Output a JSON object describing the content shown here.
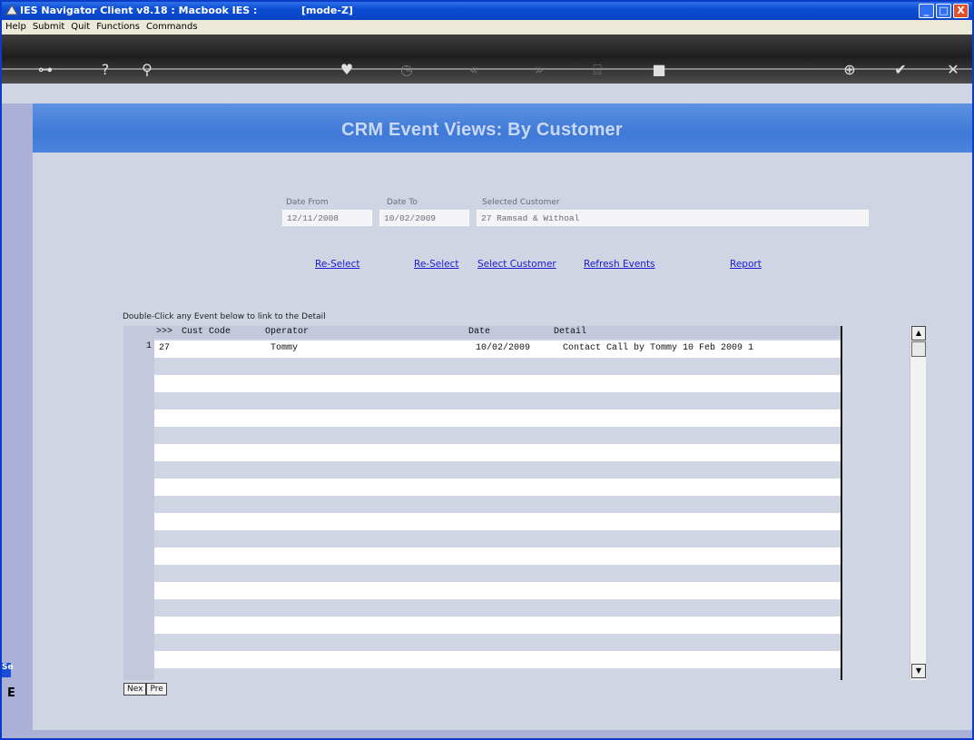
{
  "window": {
    "title": "IES Navigator Client v8.18 : Macbook IES :",
    "mode": "[mode-Z]",
    "buttons": {
      "minimize": "_",
      "maximize": "□",
      "close": "X"
    }
  },
  "menu": [
    "Help",
    "Submit",
    "Quit",
    "Functions",
    "Commands"
  ],
  "toolbar": {
    "icons": [
      "key-icon",
      "help-icon",
      "search-icon",
      "heart-icon",
      "clock-icon",
      "back-icon",
      "forward-icon",
      "tree-icon",
      "stop-icon",
      "globe-icon",
      "check-icon",
      "close-icon"
    ]
  },
  "banner": {
    "title": "CRM Event Views: By Customer"
  },
  "form": {
    "date_from_label": "Date From",
    "date_from_value": "12/11/2008",
    "date_to_label": "Date To",
    "date_to_value": "10/02/2009",
    "customer_label": "Selected Customer",
    "customer_value": "27 Ramsad & Withoal"
  },
  "actions": {
    "reselect_from": "Re-Select",
    "reselect_to": "Re-Select",
    "select_customer": "Select Customer",
    "refresh_events": "Refresh Events",
    "report": "Report"
  },
  "grid": {
    "hint": "Double-Click any Event below to link to the Detail",
    "columns": {
      "marker": ">>>",
      "cust_code": "Cust Code",
      "operator": "Operator",
      "date": "Date",
      "detail": "Detail"
    },
    "rows": [
      {
        "num": "1",
        "cust_code": "27",
        "operator": "Tommy",
        "date": "10/02/2009",
        "detail": "Contact Call by Tommy 10 Feb 2009 1"
      }
    ]
  },
  "scroll": {
    "up": "▲",
    "down": "▼"
  },
  "nav": {
    "next": "Nex",
    "prev": "Pre"
  },
  "sidebar": {
    "tab": "Se",
    "icon_letter": "E"
  }
}
